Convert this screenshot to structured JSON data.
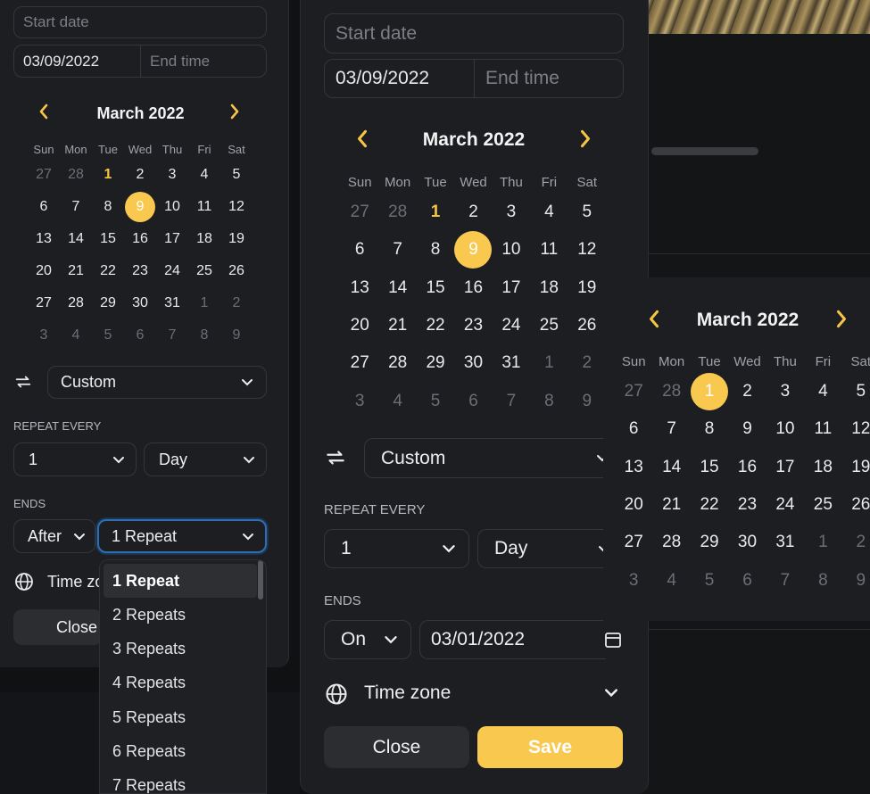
{
  "weekdays": [
    "Sun",
    "Mon",
    "Tue",
    "Wed",
    "Thu",
    "Fri",
    "Sat"
  ],
  "month_label": "March 2022",
  "calendar_days": [
    [
      "27",
      "28",
      "1",
      "2",
      "3",
      "4",
      "5"
    ],
    [
      "6",
      "7",
      "8",
      "9",
      "10",
      "11",
      "12"
    ],
    [
      "13",
      "14",
      "15",
      "16",
      "17",
      "18",
      "19"
    ],
    [
      "20",
      "21",
      "22",
      "23",
      "24",
      "25",
      "26"
    ],
    [
      "27",
      "28",
      "29",
      "30",
      "31",
      "1",
      "2"
    ],
    [
      "3",
      "4",
      "5",
      "6",
      "7",
      "8",
      "9"
    ]
  ],
  "left": {
    "start_placeholder": "Start date",
    "start_date": "03/09/2022",
    "end_placeholder": "End time",
    "selected_day": "9",
    "today_day": "1",
    "repeat_value": "Custom",
    "repeat_every_label": "REPEAT EVERY",
    "interval_value": "1",
    "unit_value": "Day",
    "ends_label": "ENDS",
    "ends_mode": "After",
    "ends_count": "1 Repeat",
    "timezone_label": "Time zone",
    "close_label": "Close",
    "dropdown_options": [
      "1 Repeat",
      "2 Repeats",
      "3 Repeats",
      "4 Repeats",
      "5 Repeats",
      "6 Repeats",
      "7 Repeats"
    ]
  },
  "middle": {
    "start_placeholder": "Start date",
    "start_date": "03/09/2022",
    "end_placeholder": "End time",
    "selected_day": "9",
    "today_day": "1",
    "repeat_value": "Custom",
    "repeat_every_label": "REPEAT EVERY",
    "interval_value": "1",
    "unit_value": "Day",
    "ends_label": "ENDS",
    "ends_mode": "On",
    "ends_date": "03/01/2022",
    "timezone_label": "Time zone",
    "close_label": "Close",
    "save_label": "Save"
  },
  "right": {
    "selected_day": "1"
  },
  "colors": {
    "accent": "#f6c545",
    "selected_fill": "#f9c94f",
    "panel_bg": "#1d1e22"
  }
}
